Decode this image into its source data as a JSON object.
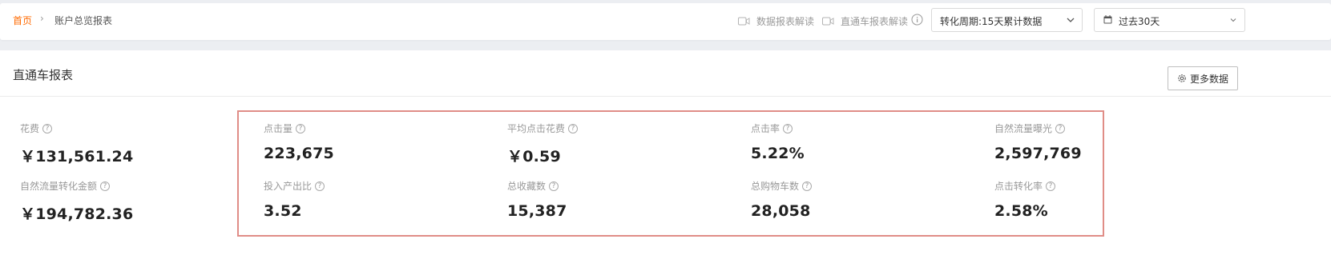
{
  "breadcrumb": {
    "home": "首页",
    "separator": "›",
    "current": "账户总览报表"
  },
  "toolbar": {
    "link1": "数据报表解读",
    "link2": "直通车报表解读",
    "conversion_select": "转化周期:15天累计数据",
    "date_select": "过去30天"
  },
  "panel": {
    "title": "直通车报表",
    "more_button": "更多数据"
  },
  "metrics": [
    {
      "label": "花费",
      "value": "￥131,561.24"
    },
    {
      "label": "点击量",
      "value": "223,675"
    },
    {
      "label": "平均点击花费",
      "value": "￥0.59"
    },
    {
      "label": "点击率",
      "value": "5.22%"
    },
    {
      "label": "自然流量曝光",
      "value": "2,597,769"
    },
    {
      "label": "自然流量转化金额",
      "value": "￥194,782.36"
    },
    {
      "label": "投入产出比",
      "value": "3.52"
    },
    {
      "label": "总收藏数",
      "value": "15,387"
    },
    {
      "label": "总购物车数",
      "value": "28,058"
    },
    {
      "label": "点击转化率",
      "value": "2.58%"
    }
  ],
  "help_glyph": "?",
  "colors": {
    "accent": "#ff6a00",
    "highlight_border": "#e08d87",
    "background": "#eceef2"
  }
}
